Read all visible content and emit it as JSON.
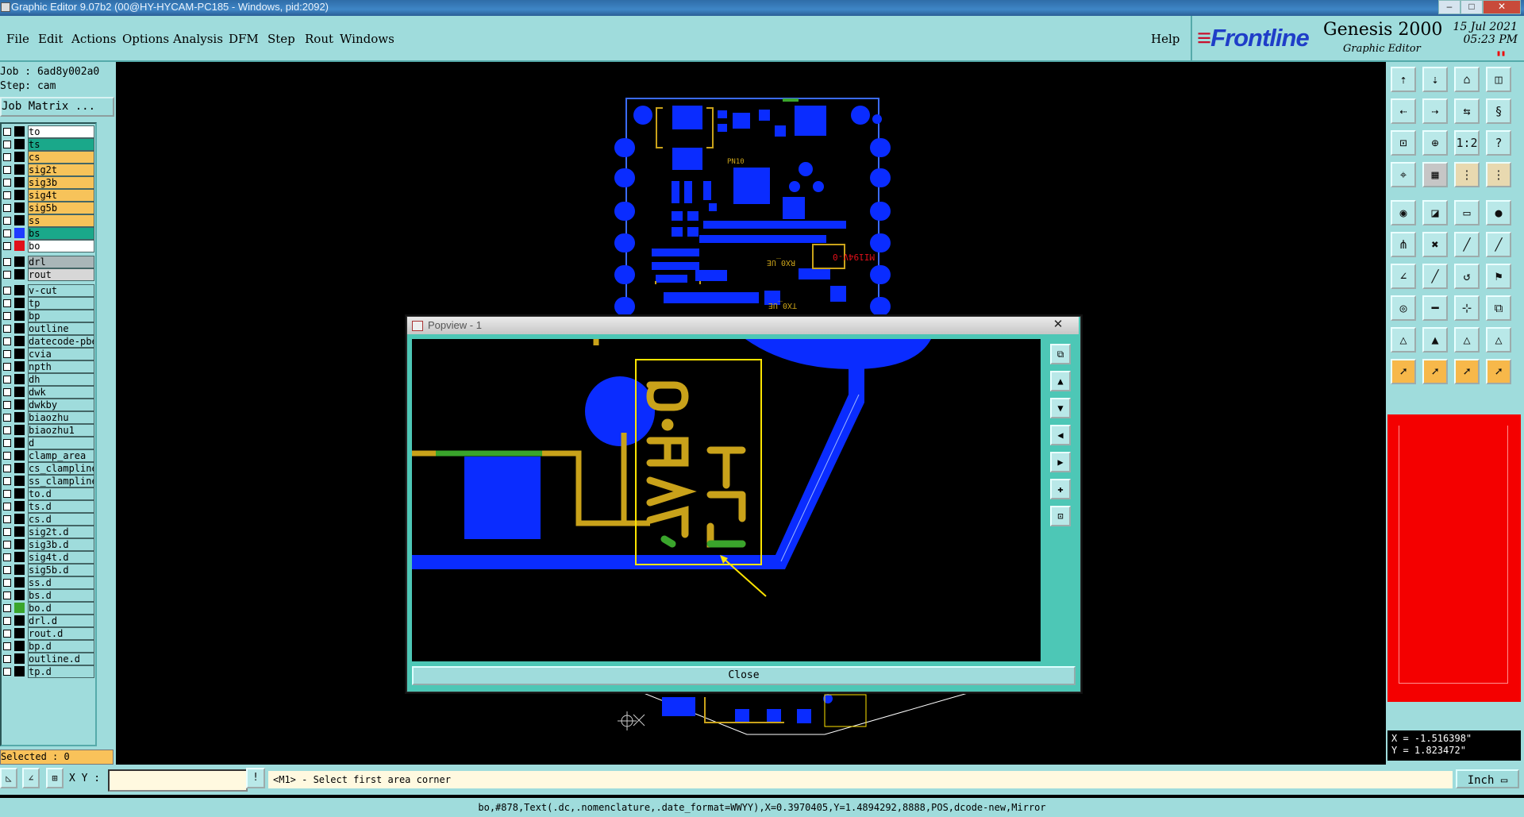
{
  "window": {
    "title": "Graphic Editor 9.07b2 (00@HY-HYCAM-PC185 - Windows, pid:2092)",
    "min": "–",
    "max": "□",
    "close": "✕"
  },
  "menu": [
    "File",
    "Edit",
    "Actions",
    "Options",
    "Analysis",
    "DFM",
    "Step",
    "Rout",
    "Windows"
  ],
  "help": "Help",
  "brand": {
    "logo": "Frontline",
    "product": "Genesis 2000",
    "sub": "Graphic Editor",
    "date": "15 Jul 2021",
    "time": "05:23 PM"
  },
  "job": {
    "job_line": "Job : 6ad8y002a0",
    "step_line": "Step: cam",
    "matrix_button": "Job Matrix ..."
  },
  "layers": [
    {
      "name": "to",
      "color": "#ffffff",
      "swatch": "#000000"
    },
    {
      "name": "ts",
      "color": "#1aa88a",
      "swatch": "#000000"
    },
    {
      "name": "cs",
      "color": "#f7c35a",
      "swatch": "#000000"
    },
    {
      "name": "sig2t",
      "color": "#f7c35a",
      "swatch": "#000000"
    },
    {
      "name": "sig3b",
      "color": "#f7c35a",
      "swatch": "#000000"
    },
    {
      "name": "sig4t",
      "color": "#f7c35a",
      "swatch": "#000000"
    },
    {
      "name": "sig5b",
      "color": "#f7c35a",
      "swatch": "#000000"
    },
    {
      "name": "ss",
      "color": "#f7c35a",
      "swatch": "#000000"
    },
    {
      "name": "bs",
      "color": "#1aa88a",
      "swatch": "#1f3cff"
    },
    {
      "name": "bo",
      "color": "#ffffff",
      "swatch": "#e0101a"
    },
    {
      "name": "drl",
      "color": "#a9b6b8",
      "swatch": "#000000"
    },
    {
      "name": "rout",
      "color": "#d7d7d7",
      "swatch": "#000000"
    },
    {
      "name": "v-cut",
      "color": "#9fdcdc",
      "swatch": "#000000"
    },
    {
      "name": "tp",
      "color": "#9fdcdc",
      "swatch": "#000000"
    },
    {
      "name": "bp",
      "color": "#9fdcdc",
      "swatch": "#000000"
    },
    {
      "name": "outline",
      "color": "#9fdcdc",
      "swatch": "#000000"
    },
    {
      "name": "datecode-pbe",
      "color": "#9fdcdc",
      "swatch": "#000000"
    },
    {
      "name": "cvia",
      "color": "#9fdcdc",
      "swatch": "#000000"
    },
    {
      "name": "npth",
      "color": "#9fdcdc",
      "swatch": "#000000"
    },
    {
      "name": "dh",
      "color": "#9fdcdc",
      "swatch": "#000000"
    },
    {
      "name": "dwk",
      "color": "#9fdcdc",
      "swatch": "#000000"
    },
    {
      "name": "dwkby",
      "color": "#9fdcdc",
      "swatch": "#000000"
    },
    {
      "name": "biaozhu",
      "color": "#9fdcdc",
      "swatch": "#000000"
    },
    {
      "name": "biaozhu1",
      "color": "#9fdcdc",
      "swatch": "#000000"
    },
    {
      "name": "d",
      "color": "#9fdcdc",
      "swatch": "#000000"
    },
    {
      "name": "clamp_area",
      "color": "#9fdcdc",
      "swatch": "#000000"
    },
    {
      "name": "cs_clampline",
      "color": "#9fdcdc",
      "swatch": "#000000"
    },
    {
      "name": "ss_clampline",
      "color": "#9fdcdc",
      "swatch": "#000000"
    },
    {
      "name": "to.d",
      "color": "#9fdcdc",
      "swatch": "#000000"
    },
    {
      "name": "ts.d",
      "color": "#9fdcdc",
      "swatch": "#000000"
    },
    {
      "name": "cs.d",
      "color": "#9fdcdc",
      "swatch": "#000000"
    },
    {
      "name": "sig2t.d",
      "color": "#9fdcdc",
      "swatch": "#000000"
    },
    {
      "name": "sig3b.d",
      "color": "#9fdcdc",
      "swatch": "#000000"
    },
    {
      "name": "sig4t.d",
      "color": "#9fdcdc",
      "swatch": "#000000"
    },
    {
      "name": "sig5b.d",
      "color": "#9fdcdc",
      "swatch": "#000000"
    },
    {
      "name": "ss.d",
      "color": "#9fdcdc",
      "swatch": "#000000"
    },
    {
      "name": "bs.d",
      "color": "#9fdcdc",
      "swatch": "#000000"
    },
    {
      "name": "bo.d",
      "color": "#9fdcdc",
      "swatch": "#3aa52c"
    },
    {
      "name": "drl.d",
      "color": "#9fdcdc",
      "swatch": "#000000"
    },
    {
      "name": "rout.d",
      "color": "#9fdcdc",
      "swatch": "#000000"
    },
    {
      "name": "bp.d",
      "color": "#9fdcdc",
      "swatch": "#000000"
    },
    {
      "name": "outline.d",
      "color": "#9fdcdc",
      "swatch": "#000000"
    },
    {
      "name": "tp.d",
      "color": "#9fdcdc",
      "swatch": "#000000"
    }
  ],
  "selected": "Selected : 0",
  "board_text": {
    "silk1": "PN10",
    "silk2": "MI194V-0",
    "silk3": "RX0_UE",
    "silk4": "TX0_UE"
  },
  "popview": {
    "title": "Popview - 1",
    "close_label": "Close",
    "glyphs_left": "AT5.0",
    "glyphs_right": "RIE"
  },
  "coords": {
    "x": "X = -1.516398\"",
    "y": "Y = 1.823472\""
  },
  "command": {
    "xy_label": "X Y :",
    "xy_value": "",
    "prompt": "<M1> - Select first area corner",
    "units": "Inch"
  },
  "status": "bo,#878,Text(.dc,.nomenclature,.date_format=WWYY),X=0.3970405,Y=1.4894292,8888,POS,dcode-new,Mirror",
  "colors": {
    "panel": "#9fdcdc",
    "copper": "#0a2cff",
    "silk": "#c9a21a",
    "highlight": "#ffe400",
    "green": "#3aa52c"
  }
}
